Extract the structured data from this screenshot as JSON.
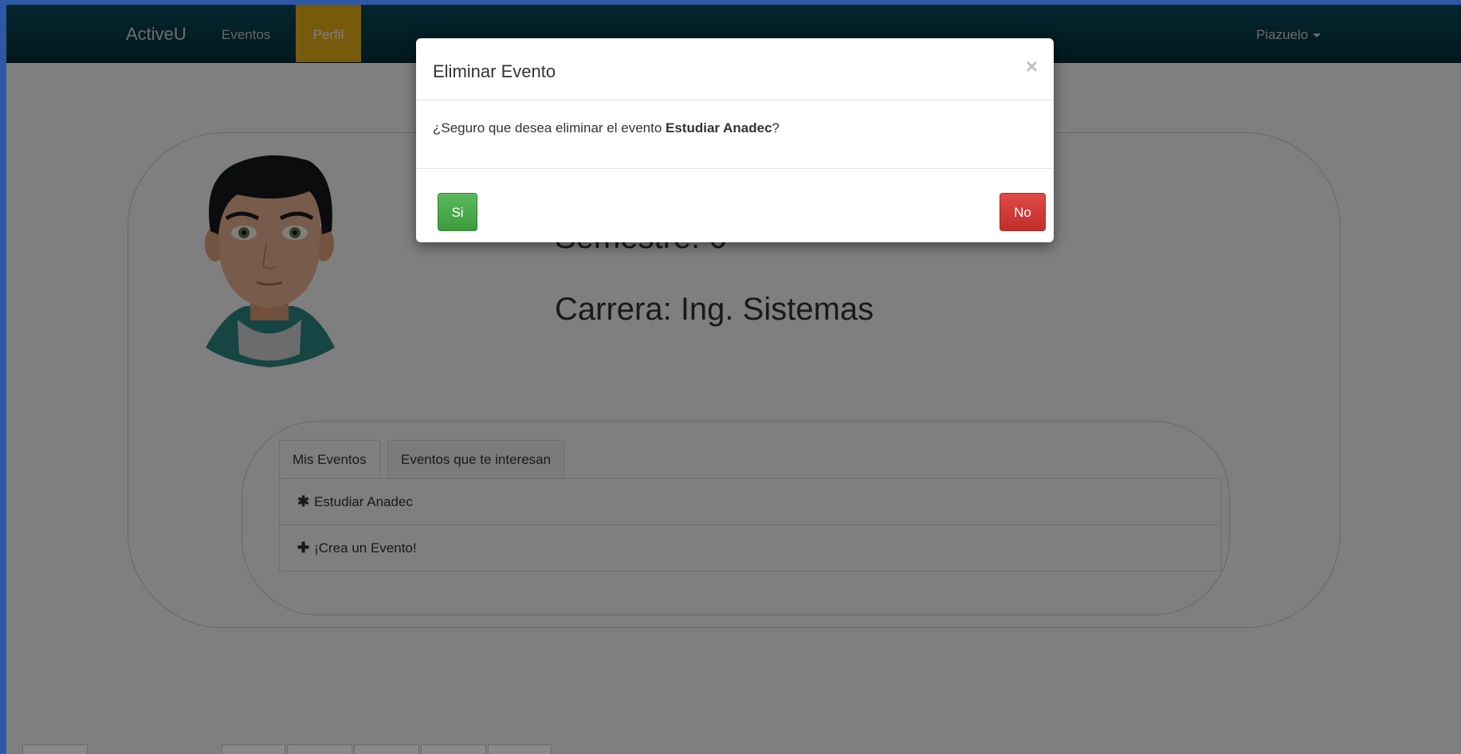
{
  "navbar": {
    "brand": "ActiveU",
    "items": [
      {
        "label": "Eventos"
      },
      {
        "label": "Perfil"
      }
    ],
    "user": "Piazuelo"
  },
  "profile": {
    "semestre": "Semestre: 6",
    "carrera": "Carrera: Ing. Sistemas"
  },
  "tabs": [
    {
      "label": "Mis Eventos"
    },
    {
      "label": "Eventos que te interesan"
    }
  ],
  "events": [
    {
      "icon": "asterisk-icon",
      "label": "Estudiar Anadec"
    },
    {
      "icon": "plus-icon",
      "label": "¡Crea un Evento!"
    }
  ],
  "modal": {
    "title": "Eliminar Evento",
    "close": "×",
    "body_prefix": "¿Seguro que desea eliminar el evento ",
    "body_event": "Estudiar Anadec",
    "body_suffix": "?",
    "confirm_label": "Si",
    "cancel_label": "No"
  },
  "colors": {
    "navbar": "#05303d",
    "active_tab": "#f0b41b",
    "btn_success": "#5cb85c",
    "btn_danger": "#d9534f"
  }
}
